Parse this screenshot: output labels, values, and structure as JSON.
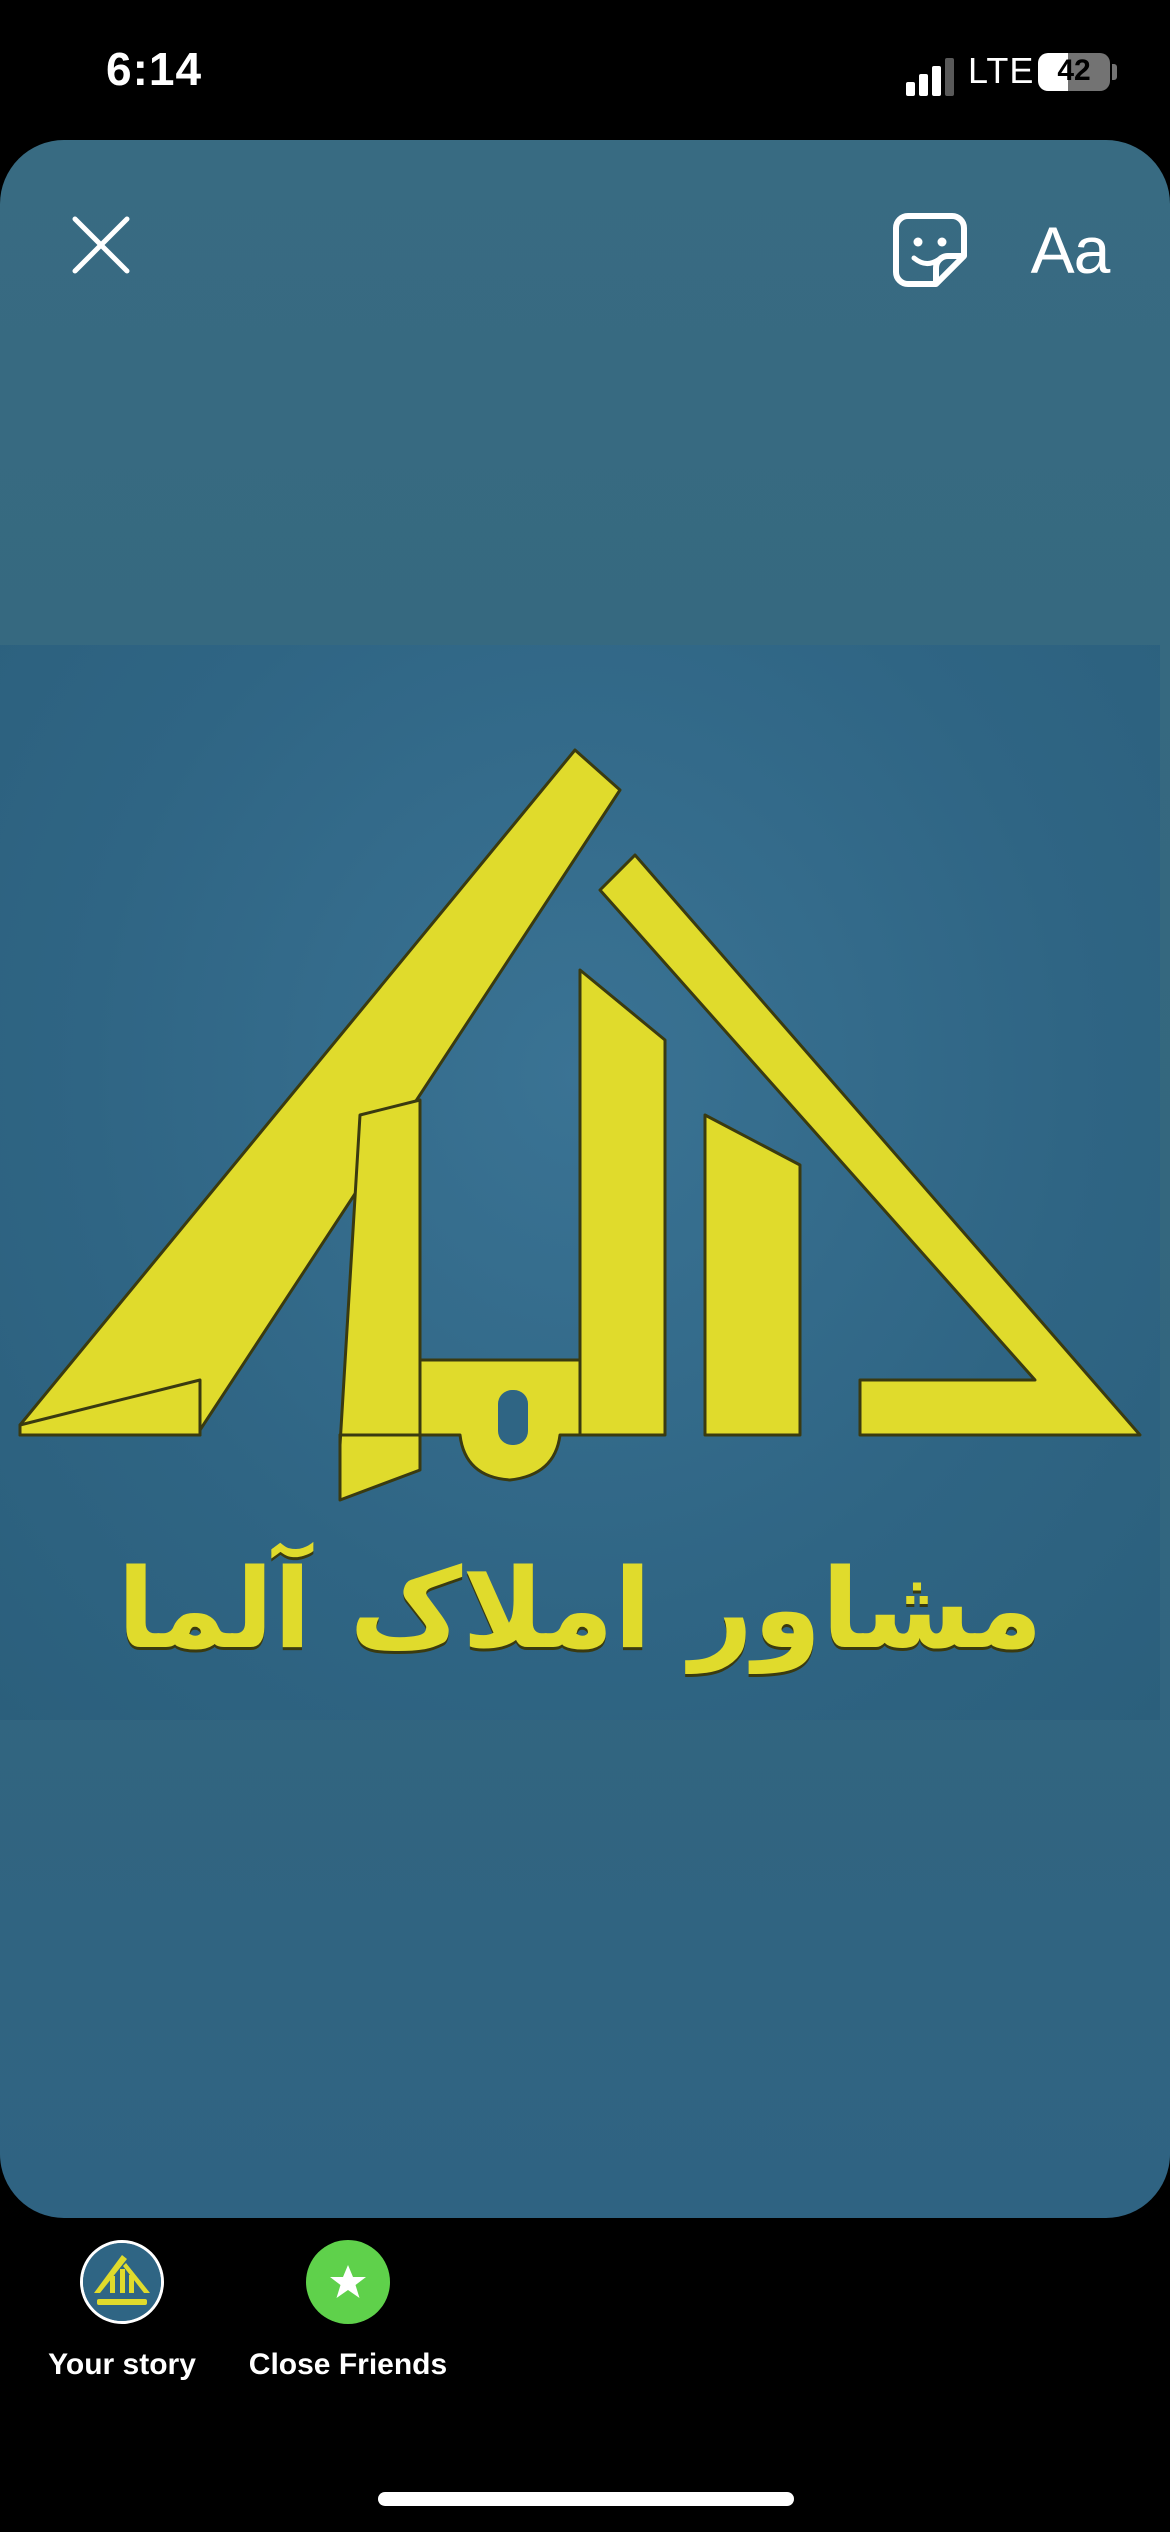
{
  "status_bar": {
    "time": "6:14",
    "network": "LTE",
    "battery_level": "42",
    "battery_fraction": 0.42,
    "signal_bars_active": 3,
    "signal_bars_total": 4
  },
  "editor": {
    "close_icon": "close-icon",
    "sticker_icon": "sticker-icon",
    "text_tool_label": "Aa"
  },
  "story_image": {
    "logo_mark": "آلما",
    "logo_caption": "مشاور املاک آلما",
    "colors": {
      "background": "#2f6584",
      "logo": "#e0db2c"
    }
  },
  "share_targets": [
    {
      "label": "Your story"
    },
    {
      "label": "Close Friends",
      "icon": "star-icon",
      "color": "#5fd14b"
    }
  ]
}
